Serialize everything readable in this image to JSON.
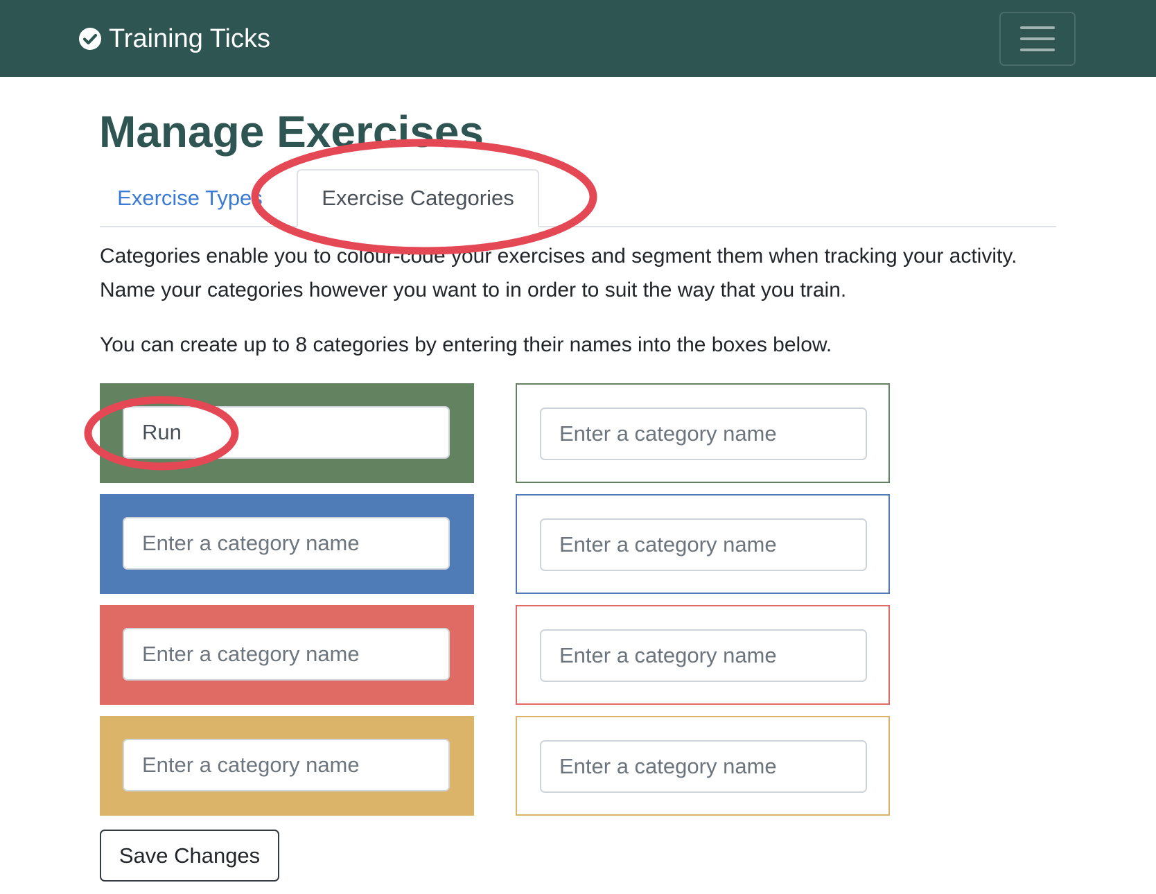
{
  "navbar": {
    "brand_text": "Training Ticks",
    "brand_icon": "check-circle-icon",
    "menu_icon": "hamburger-menu-icon",
    "background": "#2e5552"
  },
  "page": {
    "title": "Manage Exercises"
  },
  "tabs": [
    {
      "label": "Exercise Types",
      "active": false
    },
    {
      "label": "Exercise Categories",
      "active": true
    }
  ],
  "content": {
    "description": "Categories enable you to colour-code your exercises and segment them when tracking your activity. Name your categories however you want to in order to suit the way that you train.",
    "instruction": "You can create up to 8 categories by entering their names into the boxes below."
  },
  "categories": [
    {
      "value": "Run",
      "placeholder": "Enter a category name",
      "color": "#638260",
      "style": "filled"
    },
    {
      "value": "",
      "placeholder": "Enter a category name",
      "color": "#638260",
      "style": "outline"
    },
    {
      "value": "",
      "placeholder": "Enter a category name",
      "color": "#4f7bb7",
      "style": "filled"
    },
    {
      "value": "",
      "placeholder": "Enter a category name",
      "color": "#4f7bb7",
      "style": "outline"
    },
    {
      "value": "",
      "placeholder": "Enter a category name",
      "color": "#df6b64",
      "style": "filled"
    },
    {
      "value": "",
      "placeholder": "Enter a category name",
      "color": "#df6b64",
      "style": "outline"
    },
    {
      "value": "",
      "placeholder": "Enter a category name",
      "color": "#dcb469",
      "style": "filled"
    },
    {
      "value": "",
      "placeholder": "Enter a category name",
      "color": "#dcb469",
      "style": "outline"
    }
  ],
  "actions": {
    "save_label": "Save Changes"
  },
  "annotation_color": "#e34854"
}
